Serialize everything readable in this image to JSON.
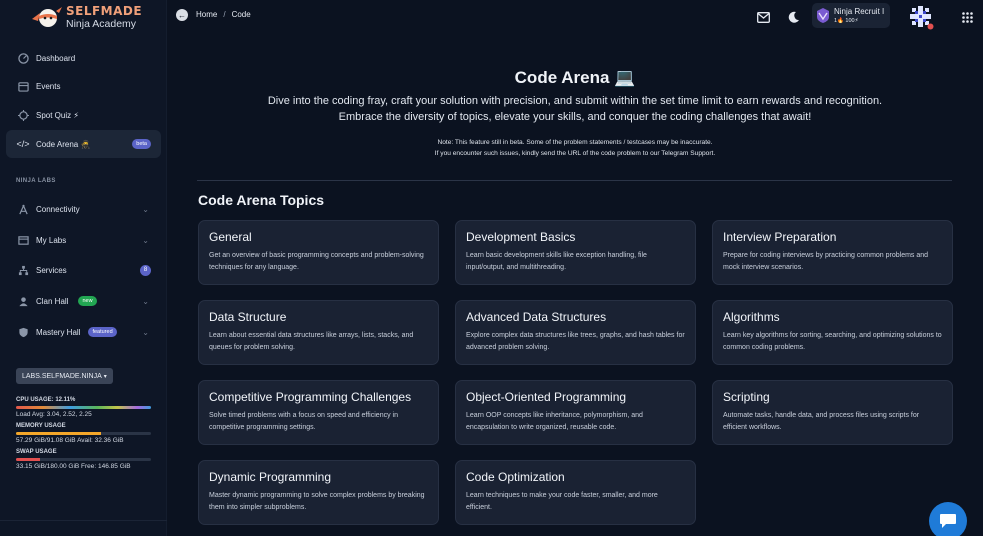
{
  "brand": {
    "title": "SELFMADE",
    "subtitle": "Ninja Academy"
  },
  "sidebar": {
    "items": [
      {
        "label": "Dashboard",
        "icon": "dashboard-icon"
      },
      {
        "label": "Events",
        "icon": "calendar-icon"
      },
      {
        "label": "Spot Quiz ⚡",
        "icon": "quiz-icon"
      },
      {
        "label": "Code Arena 🥷",
        "icon": "code-icon",
        "badge": "beta",
        "active": true
      }
    ],
    "section_label": "NINJA LABS",
    "lab_items": [
      {
        "label": "Connectivity",
        "icon": "antenna-icon"
      },
      {
        "label": "My Labs",
        "icon": "labs-icon"
      },
      {
        "label": "Services",
        "icon": "network-icon",
        "badge": "8"
      },
      {
        "label": "Clan Hall",
        "icon": "users-icon",
        "badge": "new"
      },
      {
        "label": "Mastery Hall",
        "icon": "shield-icon",
        "badge": "featured"
      }
    ],
    "labs_button": "LABS.SELFMADE.NINJA",
    "cpu_label": "CPU USAGE: 12.11%",
    "cpu_pct": 100,
    "load_avg": "Load Avg: 3.04, 2.52, 2.25",
    "memory_label": "MEMORY USAGE",
    "memory_pct": 63,
    "memory_text": "57.29 GiB/91.08 GiB Avail: 32.36 GiB",
    "swap_label": "SWAP USAGE",
    "swap_pct": 18,
    "swap_text": "33.15 GiB/180.00 GiB Free: 146.85 GiB"
  },
  "breadcrumb": {
    "home": "Home",
    "separator": "/",
    "current": "Code"
  },
  "user": {
    "name": "Ninja Recruit I",
    "stats": "1🔥 100⚡"
  },
  "hero": {
    "title": "Code Arena 💻",
    "description": "Dive into the coding fray, craft your solution with precision, and submit within the set time limit to earn rewards and recognition. Embrace the diversity of topics, elevate your skills, and conquer the coding challenges that await!",
    "note_line1": "Note: This feature still in beta. Some of the problem statements / testcases may be inaccurate.",
    "note_line2": "If you encounter such issues, kindly send the URL of the code problem to our Telegram Support."
  },
  "topics_title": "Code Arena Topics",
  "topics": [
    {
      "title": "General",
      "desc": "Get an overview of basic programming concepts and problem-solving techniques for any language."
    },
    {
      "title": "Development Basics",
      "desc": "Learn basic development skills like exception handling, file input/output, and multithreading."
    },
    {
      "title": "Interview Preparation",
      "desc": "Prepare for coding interviews by practicing common problems and mock interview scenarios."
    },
    {
      "title": "Data Structure",
      "desc": "Learn about essential data structures like arrays, lists, stacks, and queues for problem solving."
    },
    {
      "title": "Advanced Data Structures",
      "desc": "Explore complex data structures like trees, graphs, and hash tables for advanced problem solving."
    },
    {
      "title": "Algorithms",
      "desc": "Learn key algorithms for sorting, searching, and optimizing solutions to common coding problems."
    },
    {
      "title": "Competitive Programming Challenges",
      "desc": "Solve timed problems with a focus on speed and efficiency in competitive programming settings."
    },
    {
      "title": "Object-Oriented Programming",
      "desc": "Learn OOP concepts like inheritance, polymorphism, and encapsulation to write organized, reusable code."
    },
    {
      "title": "Scripting",
      "desc": "Automate tasks, handle data, and process files using scripts for efficient workflows."
    },
    {
      "title": "Dynamic Programming",
      "desc": "Master dynamic programming to solve complex problems by breaking them into simpler subproblems."
    },
    {
      "title": "Code Optimization",
      "desc": "Learn techniques to make your code faster, smaller, and more efficient."
    }
  ],
  "colors": {
    "background": "#0b1220",
    "card": "#1a2233",
    "accent": "#5b64c8",
    "brand": "#f0a07a"
  }
}
